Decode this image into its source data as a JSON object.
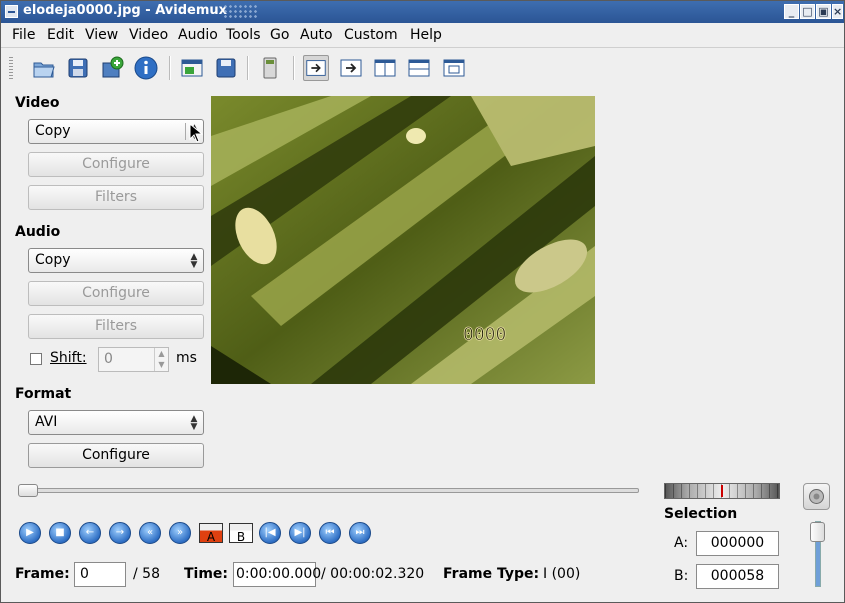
{
  "window": {
    "title": "elodeja0000.jpg - Avidemux"
  },
  "menu": [
    "File",
    "Edit",
    "View",
    "Video",
    "Audio",
    "Tools",
    "Go",
    "Auto",
    "Custom",
    "Help"
  ],
  "video": {
    "heading": "Video",
    "codec": "Copy",
    "configure_label": "Configure",
    "filters_label": "Filters"
  },
  "audio": {
    "heading": "Audio",
    "codec": "Copy",
    "configure_label": "Configure",
    "filters_label": "Filters",
    "shift_label": "Shift:",
    "shift_value": "0",
    "shift_unit": "ms"
  },
  "format": {
    "heading": "Format",
    "container": "AVI",
    "configure_label": "Configure"
  },
  "preview": {
    "overlay_counter": "0000"
  },
  "timeline": {
    "position_fraction": 0.0
  },
  "status": {
    "frame_label": "Frame:",
    "frame_value": "0",
    "frame_total": "/ 58",
    "time_label": "Time:",
    "time_value": "0:00:00.000",
    "time_total": "/ 00:00:02.320",
    "frame_type_label": "Frame Type:",
    "frame_type_value": "I (00)"
  },
  "selection": {
    "heading": "Selection",
    "a_label": "A:",
    "a_value": "000000",
    "b_label": "B:",
    "b_value": "000058"
  },
  "markers": {
    "a_label": "A",
    "b_label": "B"
  },
  "colors": {
    "titlebar": "#2b5595",
    "preview_base": "#5c6b1c"
  }
}
